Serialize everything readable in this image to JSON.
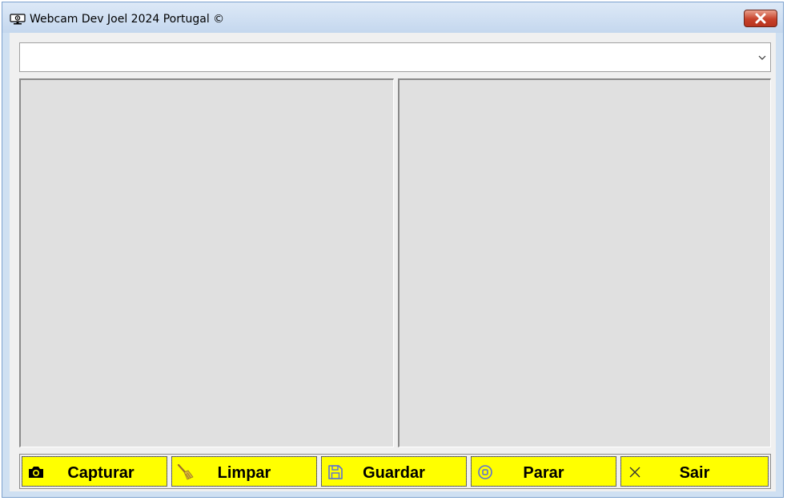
{
  "window": {
    "title": "Webcam Dev Joel 2024 Portugal ©",
    "app_icon": "webcam-icon",
    "close_icon": "close-icon"
  },
  "device_select": {
    "value": "",
    "arrow_icon": "chevron-down-icon"
  },
  "buttons": [
    {
      "label": "Capturar",
      "icon": "camera-icon"
    },
    {
      "label": "Limpar",
      "icon": "broom-icon"
    },
    {
      "label": "Guardar",
      "icon": "save-icon"
    },
    {
      "label": "Parar",
      "icon": "stop-circle-icon"
    },
    {
      "label": "Sair",
      "icon": "close-icon"
    }
  ],
  "colors": {
    "button_bg": "#ffff00",
    "panel_bg": "#e0e0e0",
    "window_frame": "#cfe0f2",
    "close_button": "#c7422b"
  }
}
